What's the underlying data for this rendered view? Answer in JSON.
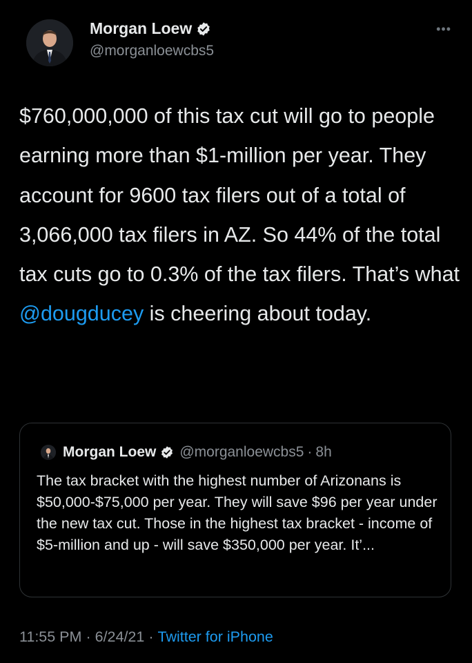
{
  "author": {
    "display_name": "Morgan Loew",
    "handle": "@morganloewcbs5",
    "verified_icon": "verified-badge-icon"
  },
  "more_label": "•••",
  "tweet": {
    "text_before": "$760,000,000 of this tax cut will go to people earning more than $1-million per year. They account for 9600 tax filers out of a total of 3,066,000 tax filers in AZ. So 44% of the total tax cuts go to 0.3% of the tax filers. That’s what ",
    "mention": "@dougducey",
    "text_after": " is cheering about today."
  },
  "quote": {
    "display_name": "Morgan Loew",
    "handle": "@morganloewcbs5",
    "separator": "·",
    "time": "8h",
    "text": "The tax bracket with the highest number of Arizonans is $50,000-$75,000 per year. They will save $96 per year under the new tax cut. Those in the highest tax bracket - income of $5-million and up - will save $350,000 per year. It’..."
  },
  "footer": {
    "time": "11:55 PM",
    "separator": "·",
    "date": "6/24/21",
    "source": "Twitter for iPhone"
  },
  "colors": {
    "background": "#000000",
    "text": "#e7e9ea",
    "secondary": "#8b9096",
    "link": "#1d9bf0",
    "border": "#2f3336"
  }
}
